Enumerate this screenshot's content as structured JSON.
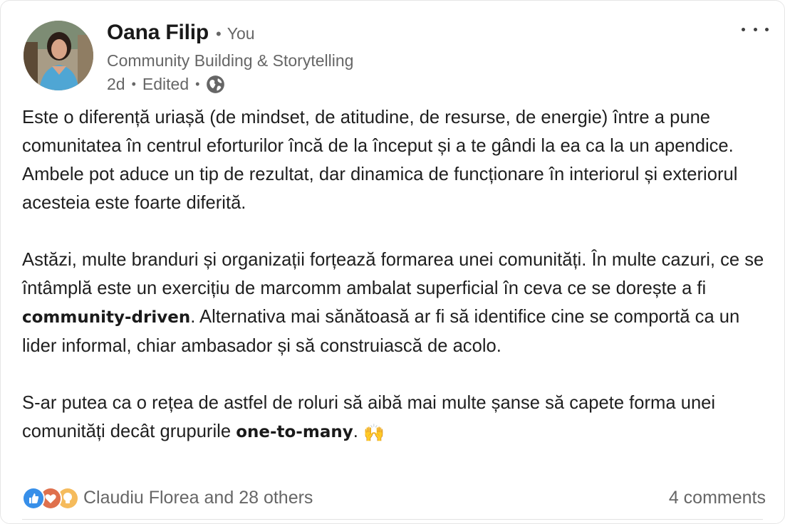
{
  "author": {
    "name": "Oana Filip",
    "relation": "You",
    "headline": "Community Building & Storytelling",
    "time": "2d",
    "edited": "Edited",
    "visibility_icon": "globe-icon"
  },
  "post": {
    "p1": "Este o diferență uriașă (de mindset, de atitudine, de resurse, de energie) între a pune comunitatea în centrul eforturilor încă de la început și a te gândi la ea ca la un apendice. Ambele pot aduce un tip de rezultat, dar dinamica de funcționare în interiorul și exteriorul acesteia este foarte diferită.",
    "p2_before": "Astăzi, multe branduri și organizații forțează formarea unei comunități. În multe cazuri, ce se întâmplă este un exercițiu de marcomm ambalat superficial în ceva ce se dorește a fi ",
    "p2_bold": "community-driven",
    "p2_after": ". Alternativa mai sănătoasă ar fi să identifice cine se comportă ca un lider informal, chiar ambasador și să construiască de acolo.",
    "p3_before": "S-ar putea ca o rețea de astfel de roluri să aibă mai multe șanse să capete forma unei comunități decât grupurile ",
    "p3_bold": "one-to-many",
    "p3_after": ".",
    "emoji": "🙌"
  },
  "social": {
    "reaction_icons": [
      "like-icon",
      "love-icon",
      "insightful-icon"
    ],
    "reactions_text": "Claudiu Florea and 28 others",
    "comments_text": "4 comments"
  },
  "colors": {
    "like": "#378fe9",
    "love": "#df704d",
    "insightful": "#f5bb5c",
    "muted_text": "#666666"
  }
}
